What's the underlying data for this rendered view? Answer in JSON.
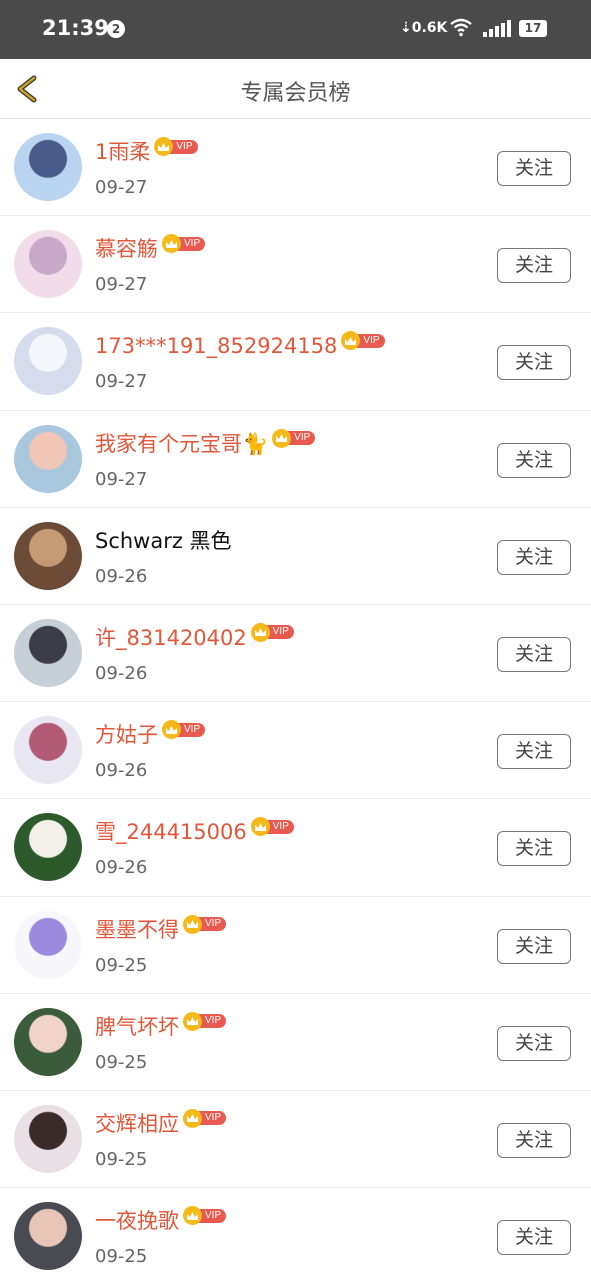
{
  "status_bar": {
    "time": "21:39",
    "notif_count": "2",
    "net_speed": "0.6K",
    "battery": "17"
  },
  "header": {
    "title": "专属会员榜",
    "back_icon": "chevron-left-icon",
    "back_color": "#c9a227"
  },
  "colors": {
    "vip_name": "#e0573a",
    "vip_tag": "#e85a4f",
    "vip_crown": "#f5b91a"
  },
  "vip_label": "VIP",
  "follow_label": "关注",
  "members": [
    {
      "name": "1雨柔",
      "date": "09-27",
      "vip": true
    },
    {
      "name": "慕容觞",
      "date": "09-27",
      "vip": true
    },
    {
      "name": "173***191_852924158",
      "date": "09-27",
      "vip": true
    },
    {
      "name": "我家有个元宝哥🐈",
      "date": "09-27",
      "vip": true
    },
    {
      "name": "Schwarz 黑色",
      "date": "09-26",
      "vip": false
    },
    {
      "name": "许_831420402",
      "date": "09-26",
      "vip": true
    },
    {
      "name": "方姑子",
      "date": "09-26",
      "vip": true
    },
    {
      "name": "雪_244415006",
      "date": "09-26",
      "vip": true
    },
    {
      "name": "墨墨不得",
      "date": "09-25",
      "vip": true
    },
    {
      "name": "脾气坏坏",
      "date": "09-25",
      "vip": true
    },
    {
      "name": "交辉相应",
      "date": "09-25",
      "vip": true
    },
    {
      "name": "一夜挽歌",
      "date": "09-25",
      "vip": true
    }
  ]
}
